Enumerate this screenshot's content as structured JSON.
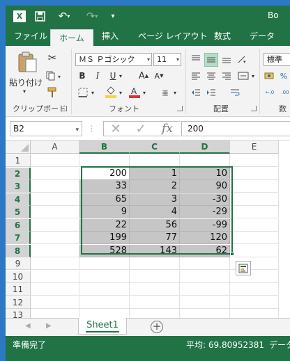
{
  "app": {
    "title_partial": "Bo",
    "logo_letter": "X",
    "colors": {
      "accent": "#217346",
      "selection_fill": "#c6c6c6",
      "header_selected": "#d3d3d3"
    }
  },
  "quick_access": [
    "save-icon",
    "undo-icon",
    "redo-icon",
    "customize-icon"
  ],
  "tabs": [
    {
      "label": "ファイル"
    },
    {
      "label": "ホーム",
      "active": true
    },
    {
      "label": "挿入"
    },
    {
      "label": "ページ レイアウト"
    },
    {
      "label": "数式"
    },
    {
      "label": "データ"
    }
  ],
  "ribbon": {
    "clipboard": {
      "label": "クリップボード",
      "paste_label": "貼り付け"
    },
    "font": {
      "label": "フォント",
      "name": "ＭＳ Ｐゴシック",
      "size": "11",
      "bold": "B",
      "italic": "I",
      "underline": "U",
      "grow": "A",
      "shrink": "A"
    },
    "alignment": {
      "label": "配置"
    },
    "number": {
      "label": "数",
      "format": "標準"
    }
  },
  "formula_bar": {
    "name_box": "B2",
    "fx": "fx",
    "value": "200"
  },
  "grid": {
    "columns": [
      "A",
      "B",
      "C",
      "D",
      "E"
    ],
    "rows": [
      "1",
      "2",
      "3",
      "4",
      "5",
      "6",
      "7",
      "8",
      "9",
      "10",
      "11",
      "12",
      "13"
    ],
    "data": [
      [
        "",
        "",
        "",
        "",
        ""
      ],
      [
        "",
        "200",
        "1",
        "10",
        ""
      ],
      [
        "",
        "33",
        "2",
        "90",
        ""
      ],
      [
        "",
        "65",
        "3",
        "-30",
        ""
      ],
      [
        "",
        "9",
        "4",
        "-29",
        ""
      ],
      [
        "",
        "22",
        "56",
        "-99",
        ""
      ],
      [
        "",
        "199",
        "77",
        "120",
        ""
      ],
      [
        "",
        "528",
        "143",
        "62",
        ""
      ],
      [
        "",
        "",
        "",
        "",
        ""
      ],
      [
        "",
        "",
        "",
        "",
        ""
      ],
      [
        "",
        "",
        "",
        "",
        ""
      ],
      [
        "",
        "",
        "",
        "",
        ""
      ],
      [
        "",
        "",
        "",
        "",
        ""
      ]
    ],
    "selection": "B2:D8",
    "active_cell": "B2"
  },
  "sheets": [
    {
      "name": "Sheet1",
      "active": true
    }
  ],
  "status": {
    "ready": "準備完了",
    "average": "平均: 69.80952381",
    "count_partial": "データ"
  }
}
